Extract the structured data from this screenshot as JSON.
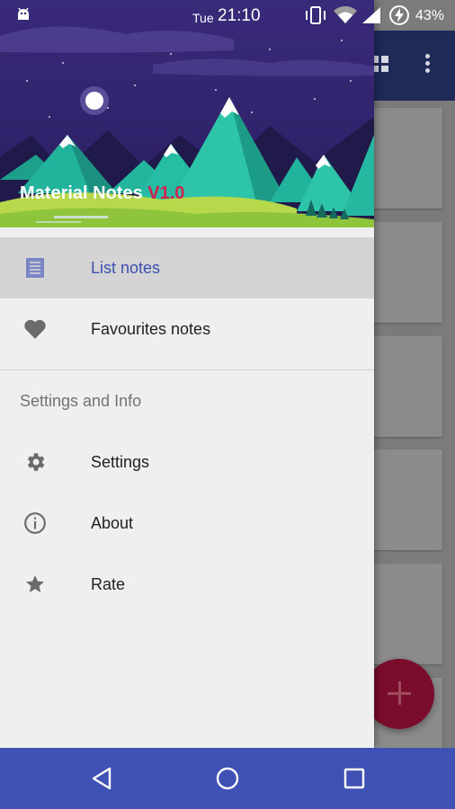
{
  "status_bar": {
    "day": "Tue",
    "time": "21:10",
    "battery": "43%"
  },
  "header": {
    "title": "Material Notes",
    "version": "V1.0"
  },
  "menu": {
    "items": [
      {
        "label": "List notes",
        "icon": "notes-list-icon"
      },
      {
        "label": "Favourites notes",
        "icon": "heart-icon"
      }
    ],
    "section_title": "Settings and Info",
    "settings_items": [
      {
        "label": "Settings",
        "icon": "gear-icon"
      },
      {
        "label": "About",
        "icon": "info-icon"
      },
      {
        "label": "Rate",
        "icon": "star-icon"
      }
    ]
  },
  "colors": {
    "accent": "#3f51b5",
    "active_text": "#3d4fb0",
    "version": "#d1234f",
    "fab": "#7a0d2b"
  }
}
